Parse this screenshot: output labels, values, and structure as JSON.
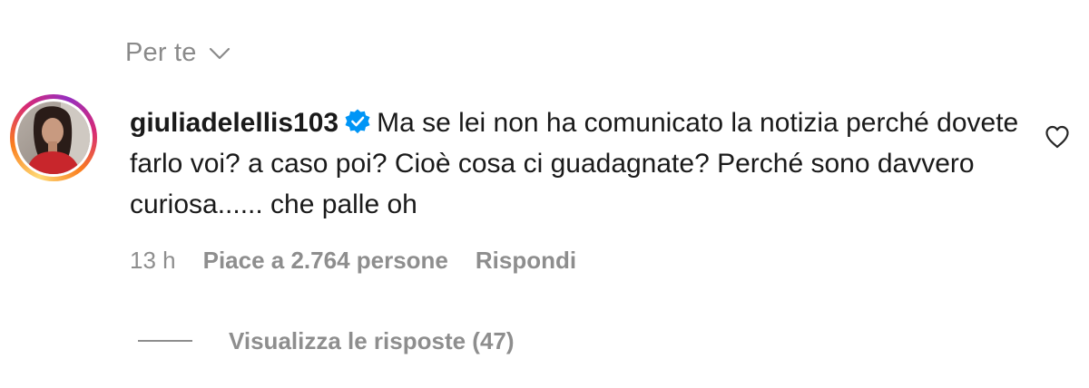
{
  "sort": {
    "label": "Per te",
    "icon": "chevron-down-icon"
  },
  "comment": {
    "username": "giuliadelellis103",
    "verified": true,
    "text": "Ma se lei non ha comunicato la notizia perché dovete farlo voi? a caso poi? Cioè cosa ci guadagnate? Perché sono davvero curiosa...... che palle oh",
    "time": "13 h",
    "likes": "Piace a 2.764 persone",
    "reply_label": "Rispondi"
  },
  "replies": {
    "label": "Visualizza le risposte (47)"
  },
  "colors": {
    "verified_blue": "#0095f6",
    "muted_text": "#8e8e8e"
  }
}
